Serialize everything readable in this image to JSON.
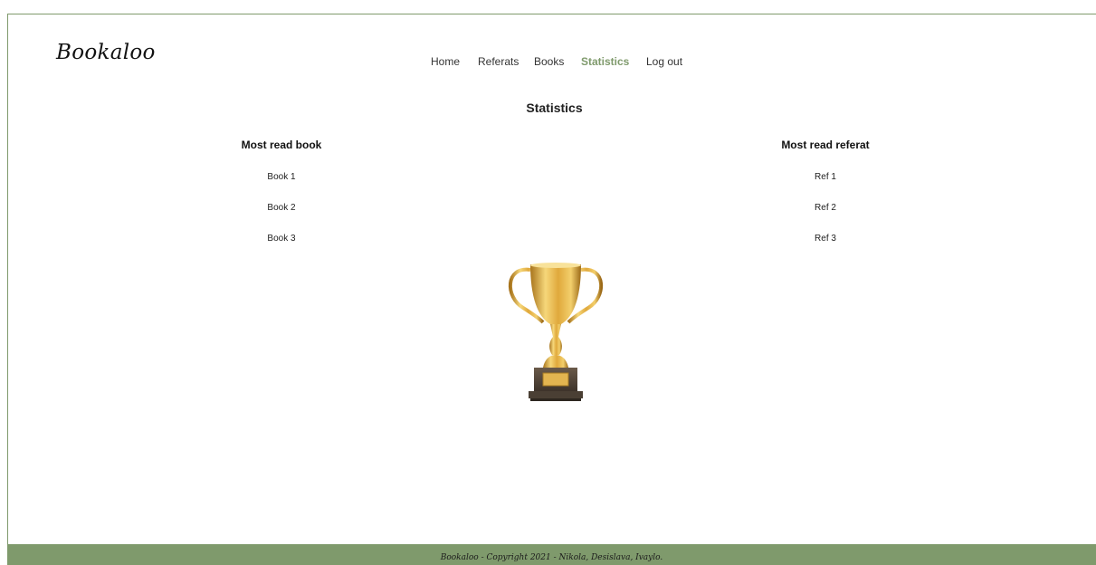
{
  "brand": {
    "name": "Bookaloo"
  },
  "nav": {
    "items": [
      {
        "label": "Home",
        "active": false
      },
      {
        "label": "Referats",
        "active": false
      },
      {
        "label": "Books",
        "active": false
      },
      {
        "label": "Statistics",
        "active": true
      },
      {
        "label": "Log out",
        "active": false
      }
    ]
  },
  "main": {
    "title": "Statistics",
    "books": {
      "heading": "Most read book",
      "items": [
        "Book 1",
        "Book 2",
        "Book 3"
      ]
    },
    "referats": {
      "heading": "Most read referat",
      "items": [
        "Ref 1",
        "Ref 2",
        "Ref 3"
      ]
    },
    "image": {
      "icon": "trophy-icon"
    }
  },
  "footer": {
    "text": "Bookaloo - Copyright 2021 - Nikola, Desislava, Ivaylo."
  },
  "colors": {
    "accent": "#7f9a6c",
    "text": "#111111",
    "background": "#ffffff"
  }
}
